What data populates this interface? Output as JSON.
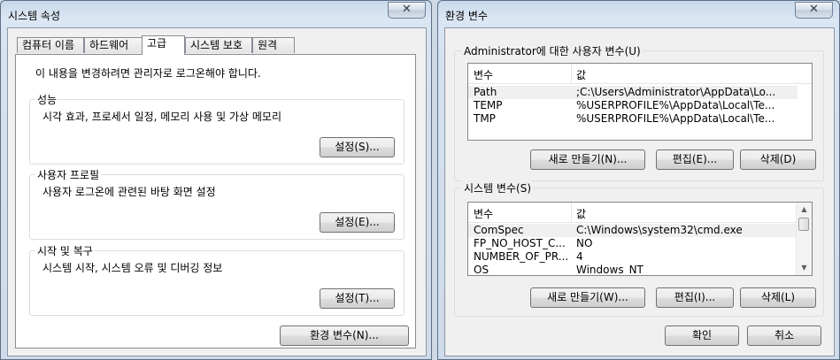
{
  "left_window": {
    "title": "시스템 속성",
    "close_glyph": "✕",
    "tabs": [
      {
        "label": "컴퓨터 이름"
      },
      {
        "label": "하드웨어"
      },
      {
        "label": "고급"
      },
      {
        "label": "시스템 보호"
      },
      {
        "label": "원격"
      }
    ],
    "note": "이 내용을 변경하려면 관리자로 로그온해야 합니다.",
    "groups": [
      {
        "label": "성능",
        "desc": "시각 효과, 프로세서 일정, 메모리 사용 및 가상 메모리",
        "button": "설정(S)..."
      },
      {
        "label": "사용자 프로필",
        "desc": "사용자 로그온에 관련된 바탕 화면 설정",
        "button": "설정(E)..."
      },
      {
        "label": "시작 및 복구",
        "desc": "시스템 시작, 시스템 오류 및 디버깅 정보",
        "button": "설정(T)..."
      }
    ],
    "env_button": "환경 변수(N)..."
  },
  "right_window": {
    "title": "환경 변수",
    "close_glyph": "✕",
    "user_section": {
      "label": "Administrator에 대한 사용자 변수(U)",
      "columns": [
        "변수",
        "값"
      ],
      "rows": [
        {
          "name": "Path",
          "value": ";C:\\Users\\Administrator\\AppData\\Lo..."
        },
        {
          "name": "TEMP",
          "value": "%USERPROFILE%\\AppData\\Local\\Te..."
        },
        {
          "name": "TMP",
          "value": "%USERPROFILE%\\AppData\\Local\\Te..."
        }
      ],
      "buttons": [
        "새로 만들기(N)...",
        "편집(E)...",
        "삭제(D)"
      ]
    },
    "system_section": {
      "label": "시스템 변수(S)",
      "columns": [
        "변수",
        "값"
      ],
      "rows": [
        {
          "name": "ComSpec",
          "value": "C:\\Windows\\system32\\cmd.exe"
        },
        {
          "name": "FP_NO_HOST_C...",
          "value": "NO"
        },
        {
          "name": "NUMBER_OF_PR...",
          "value": "4"
        },
        {
          "name": "OS",
          "value": "Windows_NT"
        }
      ],
      "buttons": [
        "새로 만들기(W)...",
        "편집(I)...",
        "삭제(L)"
      ]
    },
    "ok_button": "확인",
    "cancel_button": "취소"
  }
}
